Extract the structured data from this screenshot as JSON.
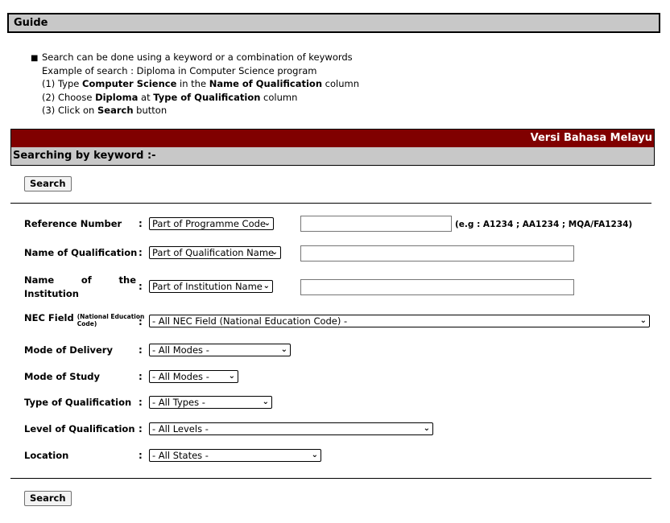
{
  "guide": {
    "title": "Guide",
    "line1": "Search can be done using a keyword or a combination of keywords",
    "line2": "Example of search : Diploma in Computer Science program",
    "line3": {
      "a": "(1) Type ",
      "b": "Computer Science",
      "c": " in the ",
      "d": "Name of Qualification",
      "e": " column"
    },
    "line4": {
      "a": "(2) Choose ",
      "b": "Diploma",
      "c": " at ",
      "d": "Type of Qualification",
      "e": " column"
    },
    "line5": {
      "a": "(3) Click on ",
      "b": "Search",
      "c": " button"
    }
  },
  "header": {
    "language_link": "Versi Bahasa Melayu",
    "section_title": "Searching by keyword :-"
  },
  "buttons": {
    "search_top": "Search",
    "search_bottom": "Search"
  },
  "form": {
    "colon": ":",
    "reference": {
      "label": "Reference Number",
      "select": "Part of Programme Code",
      "value": "",
      "hint": "(e.g : A1234 ; AA1234 ; MQA/FA1234)"
    },
    "qualification_name": {
      "label": "Name of Qualification",
      "select": "Part of Qualification Name",
      "value": ""
    },
    "institution": {
      "label_a": "Name",
      "label_b": "of",
      "label_c": "the",
      "label_d": "Institution",
      "select": "Part of Institution Name",
      "value": ""
    },
    "nec": {
      "label": "NEC Field",
      "label_small": "(National Education Code)",
      "select": "- All NEC Field (National Education Code) -"
    },
    "delivery": {
      "label": "Mode of Delivery",
      "select": "- All Modes -"
    },
    "study": {
      "label": "Mode of Study",
      "select": "- All Modes -"
    },
    "type": {
      "label": "Type of Qualification",
      "select": "- All Types -"
    },
    "level": {
      "label": "Level of Qualification",
      "select": "- All Levels -"
    },
    "location": {
      "label": "Location",
      "select": "- All States -"
    }
  },
  "icons": {
    "dropdown": "chevron-down-icon",
    "bullet": "bullet-icon"
  }
}
